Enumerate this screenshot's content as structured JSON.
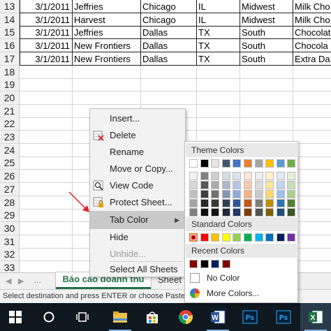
{
  "grid": {
    "row_numbers": [
      "13",
      "14",
      "15",
      "16",
      "17",
      "18",
      "19",
      "20",
      "21",
      "22",
      "23",
      "24",
      "25",
      "26",
      "27",
      "28",
      "29",
      "30",
      "31",
      "32",
      "33"
    ],
    "rows": [
      {
        "date": "3/1/2011",
        "company": "Jeffries",
        "city": "Chicago",
        "state": "IL",
        "region": "Midwest",
        "product": "Milk Cho"
      },
      {
        "date": "3/1/2011",
        "company": "Harvest",
        "city": "Chicago",
        "state": "IL",
        "region": "Midwest",
        "product": "Milk Cho"
      },
      {
        "date": "3/1/2011",
        "company": "Jeffries",
        "city": "Dallas",
        "state": "TX",
        "region": "South",
        "product": "Chocolat"
      },
      {
        "date": "3/1/2011",
        "company": "New Frontiers",
        "city": "Dallas",
        "state": "TX",
        "region": "South",
        "product": "Chocola"
      },
      {
        "date": "3/1/2011",
        "company": "New Frontiers",
        "city": "Dallas",
        "state": "TX",
        "region": "South",
        "product": "Extra Da"
      }
    ]
  },
  "context_menu": {
    "insert": "Insert...",
    "delete": "Delete",
    "rename": "Rename",
    "move_copy": "Move or Copy...",
    "view_code": "View Code",
    "protect_sheet": "Protect Sheet...",
    "tab_color": "Tab Color",
    "hide": "Hide",
    "unhide": "Unhide...",
    "select_all": "Select All Sheets"
  },
  "color_menu": {
    "theme_header": "Theme Colors",
    "standard_header": "Standard Colors",
    "recent_header": "Recent Colors",
    "no_color": "No Color",
    "more_colors": "More Colors...",
    "theme_top": [
      "#ffffff",
      "#000000",
      "#e7e6e6",
      "#44546a",
      "#4472c4",
      "#ed7d31",
      "#a5a5a5",
      "#ffc000",
      "#5b9bd5",
      "#70ad47"
    ],
    "theme_shades": [
      [
        "#f2f2f2",
        "#7f7f7f",
        "#d0cece",
        "#d6dce4",
        "#d9e2f3",
        "#fbe5d5",
        "#ededed",
        "#fff2cc",
        "#deebf6",
        "#e2efd9"
      ],
      [
        "#d8d8d8",
        "#595959",
        "#aeaaaa",
        "#adb9ca",
        "#b4c6e7",
        "#f7cbac",
        "#dbdbdb",
        "#fee599",
        "#bdd7ee",
        "#c5e0b3"
      ],
      [
        "#bfbfbf",
        "#3f3f3f",
        "#757070",
        "#8496b0",
        "#8eaadb",
        "#f4b183",
        "#c9c9c9",
        "#ffd965",
        "#9cc3e5",
        "#a8d08d"
      ],
      [
        "#a5a5a5",
        "#262626",
        "#3a3838",
        "#323f4f",
        "#2f5496",
        "#c55a11",
        "#7b7b7b",
        "#bf9000",
        "#2e75b5",
        "#538135"
      ],
      [
        "#7f7f7f",
        "#0c0c0c",
        "#171616",
        "#222a35",
        "#1f3864",
        "#833c0b",
        "#525252",
        "#7f6000",
        "#1e4e79",
        "#375623"
      ]
    ],
    "standard": [
      "#c00000",
      "#ff0000",
      "#ffc000",
      "#ffff00",
      "#92d050",
      "#00b050",
      "#00b0f0",
      "#0070c0",
      "#002060",
      "#7030a0"
    ],
    "recent": [
      "#8b0000",
      "#000000",
      "#002060",
      "#7f0000"
    ]
  },
  "sheets": {
    "active": "Báo cáo doanh thu",
    "second": "Sheet"
  },
  "status_bar": {
    "message": "Select destination and press ENTER or choose Paste"
  },
  "taskbar": {
    "icons": [
      "windows-start",
      "search",
      "task-view",
      "file-explorer",
      "store",
      "chrome",
      "word",
      "photoshop",
      "photoshop",
      "excel"
    ]
  }
}
